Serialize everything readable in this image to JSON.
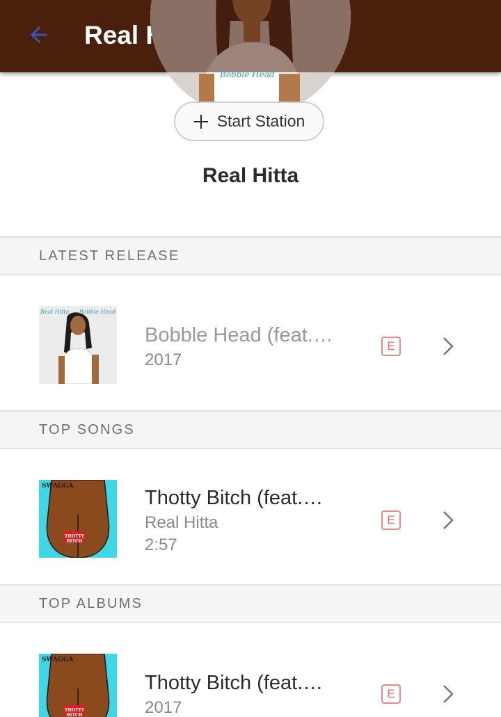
{
  "header": {
    "title": "Real Hitta",
    "back_icon": "arrow-back-icon"
  },
  "hero": {
    "artist_name": "Real Hitta",
    "avatar_caption": "Bobble Head",
    "start_station_label": "Start Station"
  },
  "sections": {
    "latest_release": {
      "title": "LATEST RELEASE",
      "item": {
        "title": "Bobble Head (feat.…",
        "year": "2017",
        "explicit": "E",
        "art_text_left": "Real Hitta",
        "art_text_right": "Bobble Head"
      }
    },
    "top_songs": {
      "title": "TOP SONGS",
      "item": {
        "title": "Thotty Bitch (feat.…",
        "artist": "Real Hitta",
        "duration": "2:57",
        "explicit": "E",
        "art_brand": "SWAGGA",
        "art_title": "THOTTY BITCH"
      }
    },
    "top_albums": {
      "title": "TOP ALBUMS",
      "item": {
        "title": "Thotty Bitch (feat.…",
        "year": "2017",
        "explicit": "E",
        "art_brand": "SWAGGA",
        "art_title": "THOTTY BITCH"
      }
    }
  },
  "colors": {
    "app_bar": "#4a1f0c",
    "back_arrow": "#3f51b5",
    "explicit": "#e46e68"
  }
}
